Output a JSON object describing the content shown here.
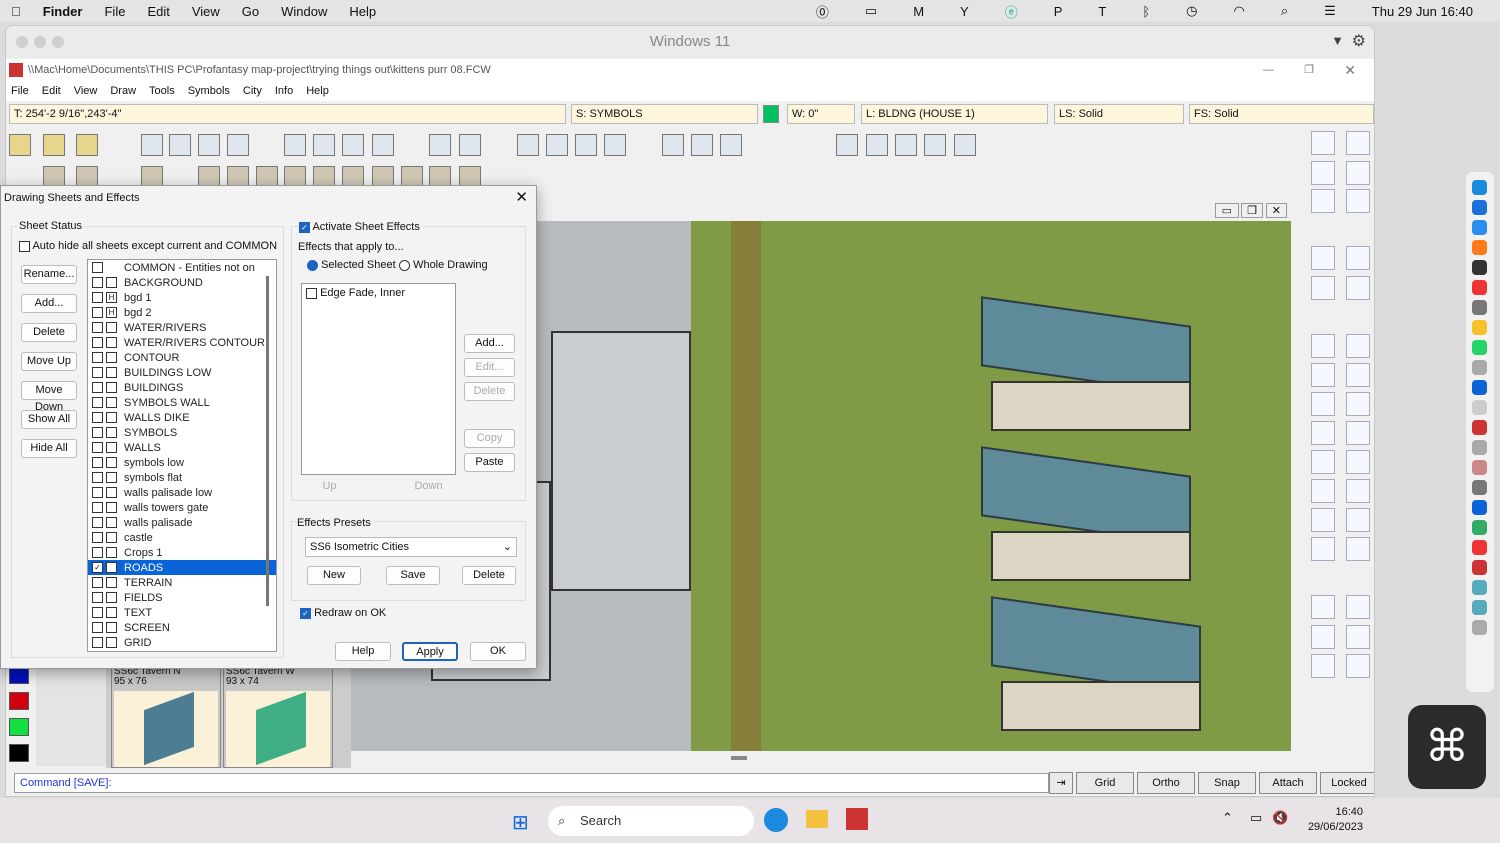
{
  "mac_menubar": {
    "apple": "",
    "app": "Finder",
    "items": [
      "File",
      "Edit",
      "View",
      "Go",
      "Window",
      "Help"
    ],
    "clock": "Thu 29 Jun  16:40"
  },
  "window": {
    "title": "Windows 11",
    "path": "\\\\Mac\\Home\\Documents\\THIS PC\\Profantasy map-project\\trying things out\\kittens purr 08.FCW"
  },
  "menu": [
    "File",
    "Edit",
    "View",
    "Draw",
    "Tools",
    "Symbols",
    "City",
    "Info",
    "Help"
  ],
  "status_fields": {
    "coords": "T: 254'-2 9/16\",243'-4\"",
    "sheet": "S: SYMBOLS",
    "color": "#00c060",
    "width": "W: 0\"",
    "layer": "L: BLDNG (HOUSE 1)",
    "line_style": "LS: Solid",
    "fill_style": "FS: Solid"
  },
  "dialog": {
    "title": "Drawing Sheets and Effects",
    "sheet_status": "Sheet Status",
    "auto_hide": "Auto hide all sheets except current and COMMON",
    "buttons": [
      "Rename...",
      "Add...",
      "Delete",
      "Move Up",
      "Move Down",
      "Show All",
      "Hide All"
    ],
    "sheets": [
      {
        "name": "COMMON - Entities not on",
        "hidden": false,
        "second": null
      },
      {
        "name": "BACKGROUND",
        "hidden": false,
        "second": ""
      },
      {
        "name": "bgd 1",
        "hidden": false,
        "second": "H"
      },
      {
        "name": "bgd 2",
        "hidden": false,
        "second": "H"
      },
      {
        "name": "WATER/RIVERS",
        "second": ""
      },
      {
        "name": "WATER/RIVERS CONTOUR",
        "second": ""
      },
      {
        "name": "CONTOUR",
        "second": ""
      },
      {
        "name": "BUILDINGS LOW",
        "second": ""
      },
      {
        "name": "BUILDINGS",
        "second": ""
      },
      {
        "name": "SYMBOLS WALL",
        "second": ""
      },
      {
        "name": "WALLS DIKE",
        "second": ""
      },
      {
        "name": "SYMBOLS",
        "second": ""
      },
      {
        "name": "WALLS",
        "second": ""
      },
      {
        "name": "symbols low",
        "second": ""
      },
      {
        "name": "symbols flat",
        "second": ""
      },
      {
        "name": "walls palisade low",
        "second": ""
      },
      {
        "name": "walls towers gate",
        "second": ""
      },
      {
        "name": "walls palisade",
        "second": ""
      },
      {
        "name": "castle",
        "second": ""
      },
      {
        "name": "Crops 1",
        "second": ""
      },
      {
        "name": "ROADS",
        "second": "",
        "checked": true,
        "selected": true
      },
      {
        "name": "TERRAIN",
        "second": ""
      },
      {
        "name": "FIELDS",
        "second": ""
      },
      {
        "name": "TEXT",
        "second": ""
      },
      {
        "name": "SCREEN",
        "second": ""
      },
      {
        "name": "GRID",
        "second": ""
      }
    ],
    "activate_effects": "Activate Sheet Effects",
    "effects_apply": "Effects that apply to...",
    "radio_selected": "Selected Sheet",
    "radio_whole": "Whole Drawing",
    "effects": [
      "Edge Fade, Inner"
    ],
    "effect_buttons": {
      "add": "Add...",
      "edit": "Edit...",
      "delete": "Delete",
      "copy": "Copy",
      "paste": "Paste",
      "up": "Up",
      "down": "Down"
    },
    "presets_label": "Effects Presets",
    "preset_value": "SS6 Isometric Cities",
    "preset_new": "New",
    "preset_save": "Save",
    "preset_delete": "Delete",
    "redraw": "Redraw on OK",
    "help": "Help",
    "apply": "Apply",
    "ok": "OK"
  },
  "symbols": [
    {
      "name": "SS6c Tavern N",
      "size": "95 x 76"
    },
    {
      "name": "SS6c Tavern W",
      "size": "93 x 74"
    }
  ],
  "palette": [
    "#0010c0",
    "#d00010",
    "#10e040",
    "#000000"
  ],
  "command": "Command [SAVE]:",
  "mode_buttons": [
    "Grid",
    "Ortho",
    "Snap",
    "Attach",
    "Locked"
  ],
  "taskbar": {
    "search": "Search",
    "time": "16:40",
    "date": "29/06/2023"
  }
}
